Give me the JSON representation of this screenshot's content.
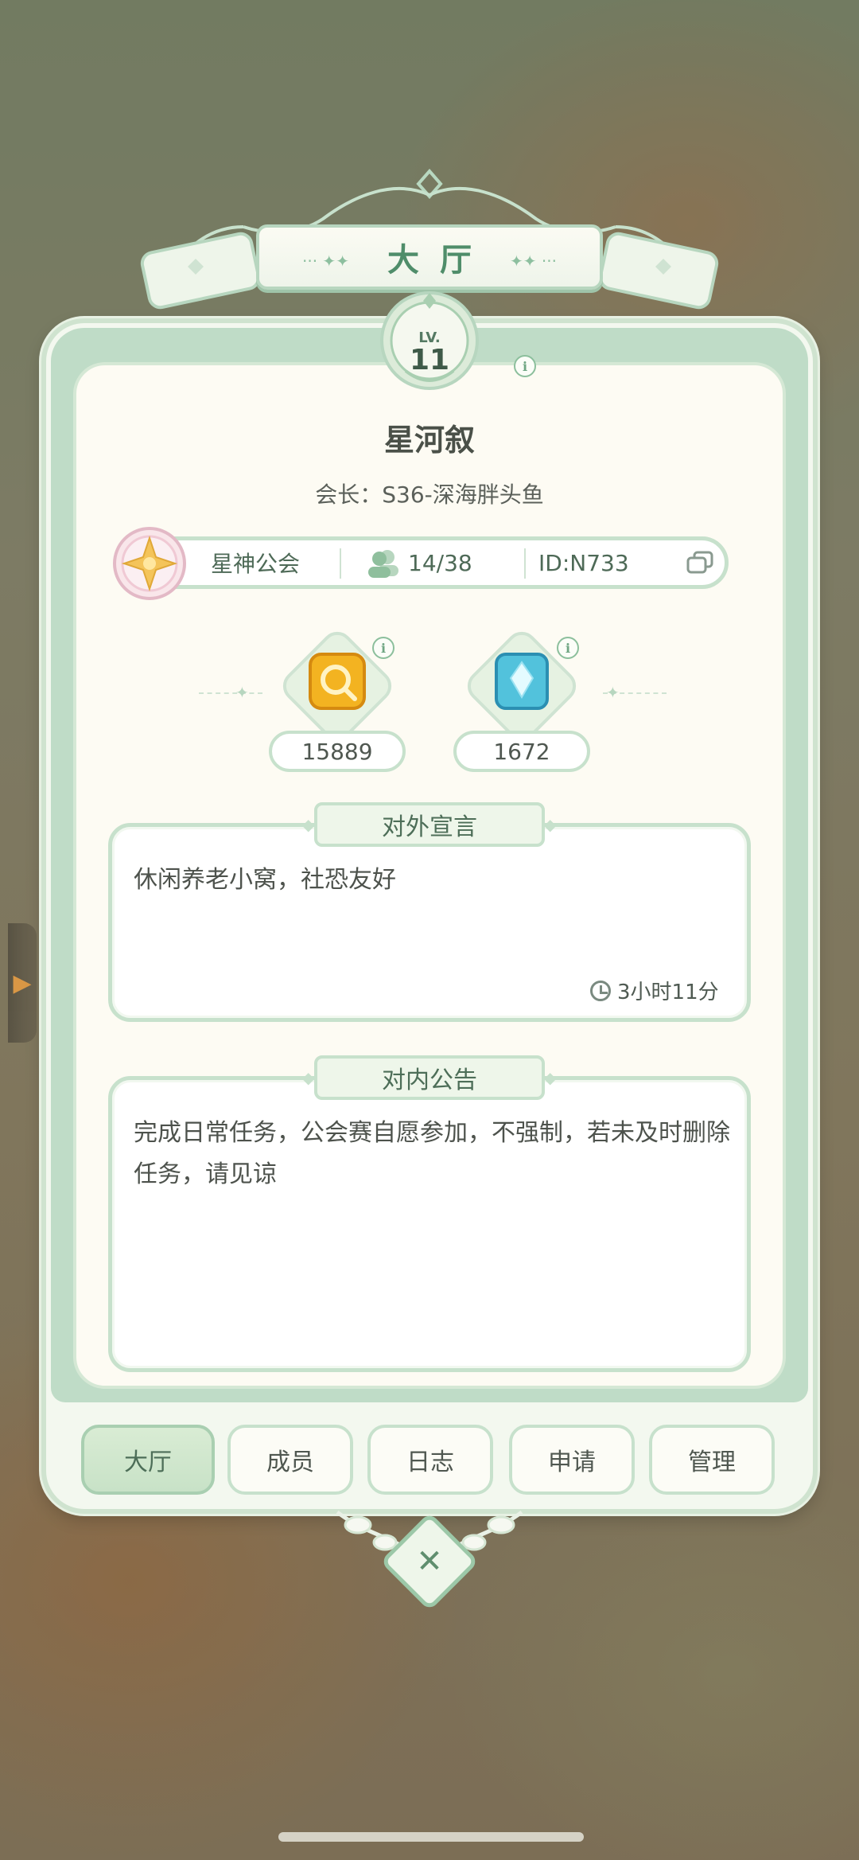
{
  "header": {
    "title": "大厅"
  },
  "level": {
    "prefix": "LV.",
    "value": "11"
  },
  "guild": {
    "name": "星河叙",
    "leader": "会长：S36-深海胖头鱼",
    "alliance": "星神公会",
    "members": "14/38",
    "id": "ID:N733"
  },
  "currencies": [
    {
      "icon": "gold-coin-icon",
      "value": "15889"
    },
    {
      "icon": "blue-crystal-icon",
      "value": "1672"
    }
  ],
  "declaration": {
    "title": "对外宣言",
    "text": "休闲养老小窝，社恐友好",
    "time": "3小时11分"
  },
  "announcement": {
    "title": "对内公告",
    "text": "完成日常任务，公会赛自愿参加，不强制，若未及时删除任务，请见谅"
  },
  "tabs": [
    {
      "label": "大厅",
      "active": true
    },
    {
      "label": "成员"
    },
    {
      "label": "日志"
    },
    {
      "label": "申请"
    },
    {
      "label": "管理"
    }
  ],
  "colors": {
    "accent": "#4f8d6a",
    "panel": "#fdfbf3",
    "border": "#c7e1cc"
  }
}
